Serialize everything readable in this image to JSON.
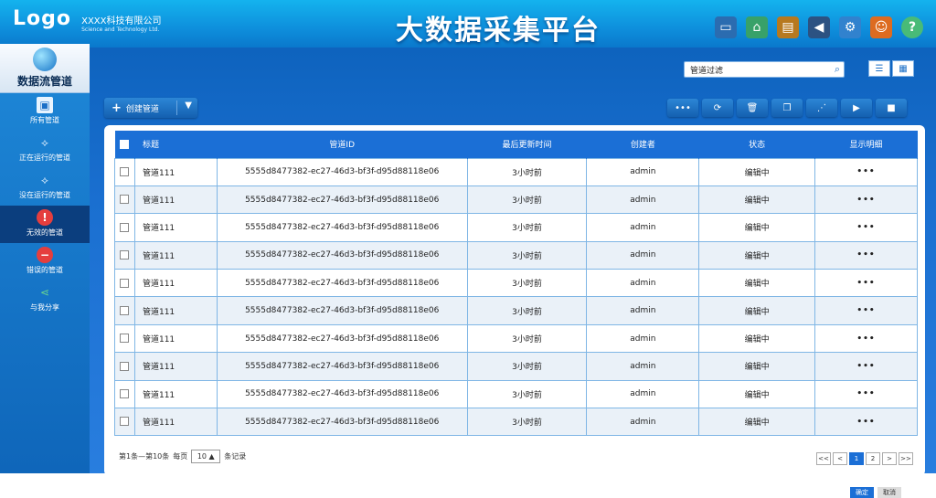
{
  "header": {
    "logo": "Logo",
    "company_cn": "XXXX科技有限公司",
    "company_en": "Science and Technology Ltd.",
    "title": "大数据采集平台",
    "help_glyph": "?"
  },
  "sidebar": {
    "top_label": "数据流管道",
    "items": [
      {
        "label": "所有管道",
        "icon": "monitor-icon",
        "active": false
      },
      {
        "label": "正在运行的管道",
        "icon": "pipeline-icon",
        "active": false
      },
      {
        "label": "没在运行的管道",
        "icon": "pipeline-icon",
        "active": false
      },
      {
        "label": "无效的管道",
        "icon": "warning-icon",
        "active": true
      },
      {
        "label": "错误的管道",
        "icon": "error-icon",
        "active": false
      },
      {
        "label": "与我分享",
        "icon": "share-icon",
        "active": false
      }
    ]
  },
  "filter": {
    "placeholder": "管道过滤"
  },
  "toolbar": {
    "create_label": "创建管道"
  },
  "table": {
    "headers": {
      "title": "标题",
      "id": "管道ID",
      "updated": "最后更新时间",
      "creator": "创建者",
      "status": "状态",
      "detail": "显示明细"
    },
    "rows": [
      {
        "title": "管道111",
        "id": "5555d8477382-ec27-46d3-bf3f-d95d88118e06",
        "updated": "3小时前",
        "creator": "admin",
        "status": "编辑中",
        "detail": "•••"
      },
      {
        "title": "管道111",
        "id": "5555d8477382-ec27-46d3-bf3f-d95d88118e06",
        "updated": "3小时前",
        "creator": "admin",
        "status": "编辑中",
        "detail": "•••"
      },
      {
        "title": "管道111",
        "id": "5555d8477382-ec27-46d3-bf3f-d95d88118e06",
        "updated": "3小时前",
        "creator": "admin",
        "status": "编辑中",
        "detail": "•••"
      },
      {
        "title": "管道111",
        "id": "5555d8477382-ec27-46d3-bf3f-d95d88118e06",
        "updated": "3小时前",
        "creator": "admin",
        "status": "编辑中",
        "detail": "•••"
      },
      {
        "title": "管道111",
        "id": "5555d8477382-ec27-46d3-bf3f-d95d88118e06",
        "updated": "3小时前",
        "creator": "admin",
        "status": "编辑中",
        "detail": "•••"
      },
      {
        "title": "管道111",
        "id": "5555d8477382-ec27-46d3-bf3f-d95d88118e06",
        "updated": "3小时前",
        "creator": "admin",
        "status": "编辑中",
        "detail": "•••"
      },
      {
        "title": "管道111",
        "id": "5555d8477382-ec27-46d3-bf3f-d95d88118e06",
        "updated": "3小时前",
        "creator": "admin",
        "status": "编辑中",
        "detail": "•••"
      },
      {
        "title": "管道111",
        "id": "5555d8477382-ec27-46d3-bf3f-d95d88118e06",
        "updated": "3小时前",
        "creator": "admin",
        "status": "编辑中",
        "detail": "•••"
      },
      {
        "title": "管道111",
        "id": "5555d8477382-ec27-46d3-bf3f-d95d88118e06",
        "updated": "3小时前",
        "creator": "admin",
        "status": "编辑中",
        "detail": "•••"
      },
      {
        "title": "管道111",
        "id": "5555d8477382-ec27-46d3-bf3f-d95d88118e06",
        "updated": "3小时前",
        "creator": "admin",
        "status": "编辑中",
        "detail": "•••"
      }
    ]
  },
  "footer": {
    "range_text": "第1条—第10条",
    "per_page_label": "每页",
    "per_page_value": "10",
    "records_label": "条记录"
  },
  "pagination": {
    "first": "<<",
    "prev": "<",
    "pages": [
      "1",
      "2"
    ],
    "current": "1",
    "next": ">",
    "last": ">>"
  },
  "dialog": {
    "ok": "确定",
    "cancel": "取消"
  }
}
